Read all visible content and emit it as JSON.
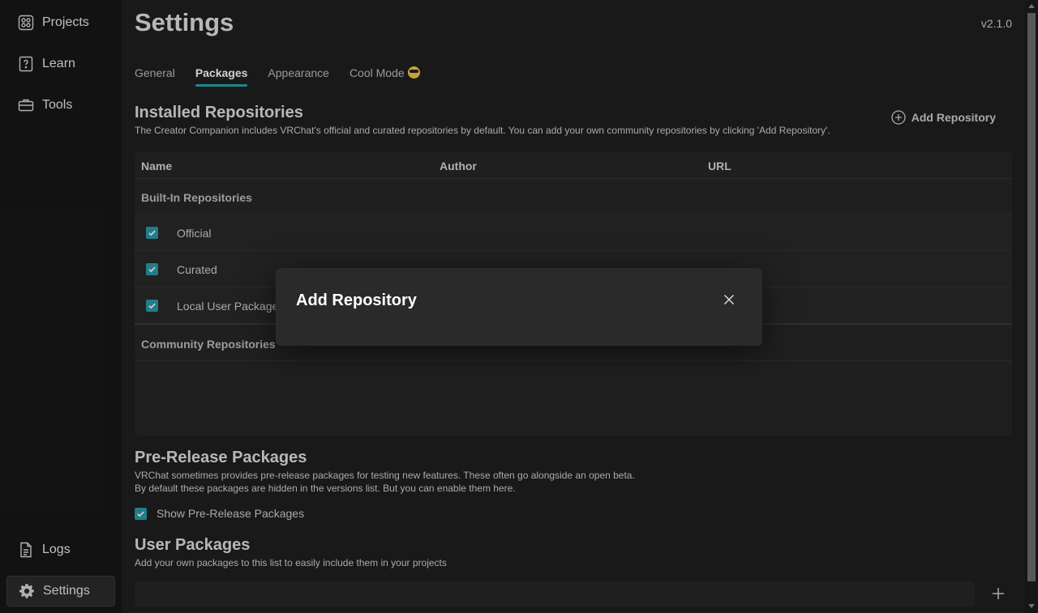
{
  "sidebar": {
    "top_items": [
      {
        "label": "Projects",
        "icon": "projects-grid-icon"
      },
      {
        "label": "Learn",
        "icon": "question-book-icon"
      },
      {
        "label": "Tools",
        "icon": "toolbox-icon"
      }
    ],
    "bottom_items": [
      {
        "label": "Logs",
        "icon": "log-file-icon"
      },
      {
        "label": "Settings",
        "icon": "gear-icon",
        "active": true
      }
    ]
  },
  "header": {
    "title": "Settings",
    "version": "v2.1.0"
  },
  "tabs": [
    {
      "label": "General"
    },
    {
      "label": "Packages",
      "active": true
    },
    {
      "label": "Appearance"
    },
    {
      "label": "Cool Mode"
    }
  ],
  "installed": {
    "title": "Installed Repositories",
    "description": "The Creator Companion includes VRChat's official and curated repositories by default. You can add your own community repositories by clicking 'Add Repository'.",
    "add_button_label": "Add Repository",
    "columns": [
      "Name",
      "Author",
      "URL"
    ],
    "built_in_label": "Built-In Repositories",
    "built_in": [
      {
        "name": "Official",
        "checked": true
      },
      {
        "name": "Curated",
        "checked": true
      },
      {
        "name": "Local User Packages",
        "checked": true
      }
    ],
    "community_label": "Community Repositories"
  },
  "prerelease": {
    "title": "Pre-Release Packages",
    "description_line1": "VRChat sometimes provides pre-release packages for testing new features. These often go alongside an open beta.",
    "description_line2": "By default these packages are hidden in the versions list. But you can enable them here.",
    "checkbox_label": "Show Pre-Release Packages",
    "checked": true
  },
  "user_packages": {
    "title": "User Packages",
    "description": "Add your own packages to this list to easily include them in your projects",
    "input_value": ""
  },
  "dialog": {
    "title": "Add Repository"
  },
  "colors": {
    "accent": "#27a3b0",
    "background": "#1f1f1f",
    "sidebar": "#171717"
  }
}
